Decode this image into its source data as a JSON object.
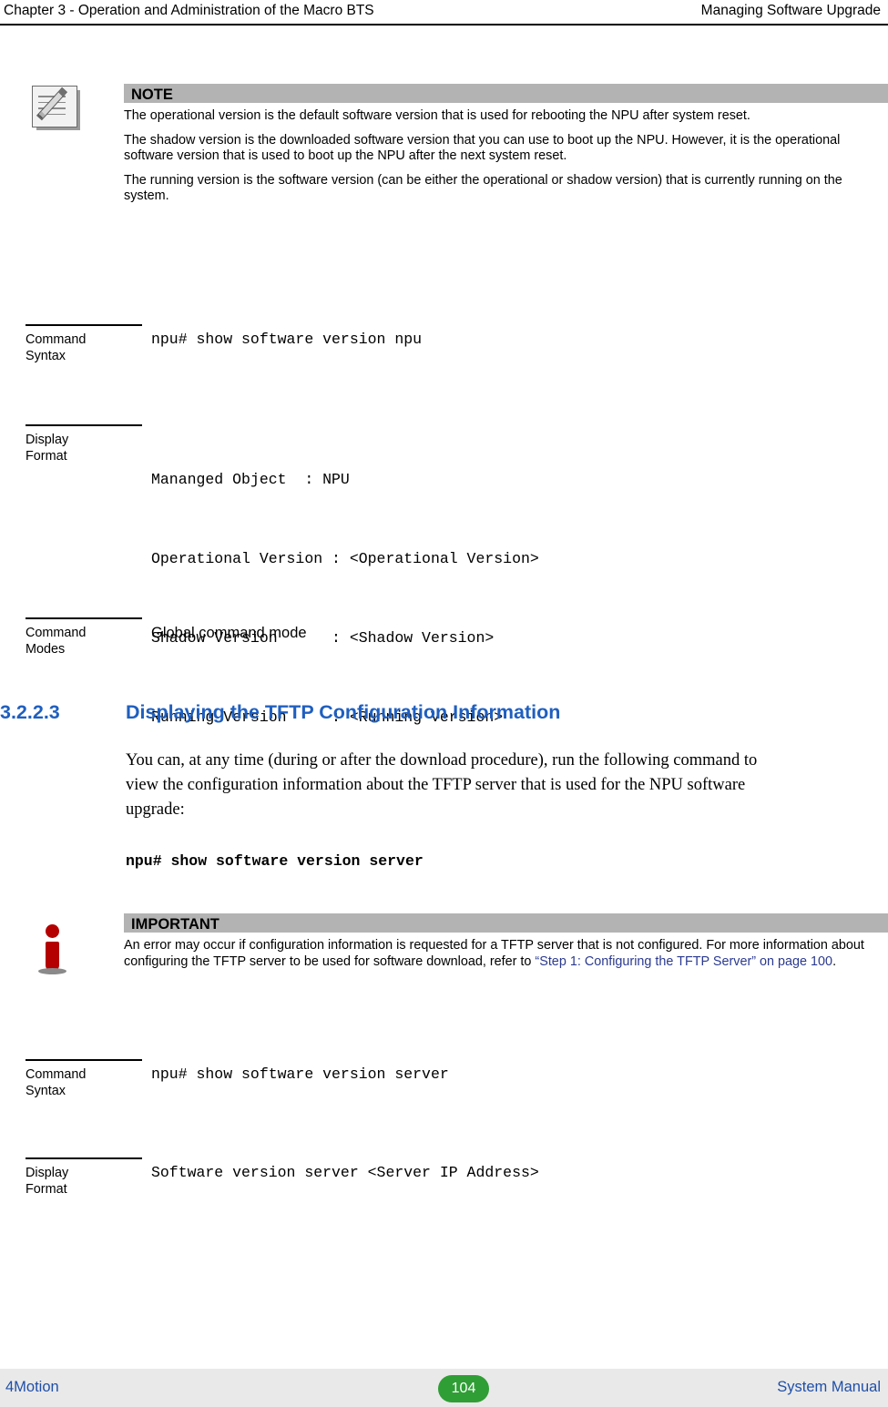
{
  "header": {
    "left": "Chapter 3 - Operation and Administration of the Macro BTS",
    "right": "Managing Software Upgrade"
  },
  "note": {
    "icon": "note-pencil-icon",
    "title": "NOTE",
    "paragraphs": [
      "The operational version is the default software version that is used for rebooting the NPU after system reset.",
      "The shadow version is the downloaded software version that you can use to boot up the NPU. However, it is the operational software version that is used to boot up the NPU after the next system reset.",
      "The running version is the software version (can be either the operational or shadow version) that is currently running on the system."
    ]
  },
  "block_syntax_1": {
    "label_line1": "Command",
    "label_line2": "Syntax",
    "value": "npu# show software version npu"
  },
  "block_display_1": {
    "label_line1": "Display",
    "label_line2": "Format",
    "lines": [
      "Mananged Object  : NPU",
      "Operational Version : <Operational Version>",
      "Shadow Version      : <Shadow Version>",
      "Running Version     : <Running Version>"
    ]
  },
  "block_modes_1": {
    "label_line1": "Command",
    "label_line2": "Modes",
    "value": "Global command mode"
  },
  "section": {
    "number": "3.2.2.3",
    "title": "Displaying the TFTP Configuration Information"
  },
  "paragraph": "You can, at any time (during or after the download procedure), run the following command to view the configuration information about the TFTP server that is used for the NPU software upgrade:",
  "inline_command": "npu# show software version server",
  "important": {
    "icon": "important-info-icon",
    "title": "IMPORTANT",
    "text_before_link": "An error may occur if configuration information is requested for a TFTP server that is not configured. For more information about configuring the TFTP server to be used for software download, refer to ",
    "link_text": "“Step 1: Configuring the TFTP Server” on page 100",
    "text_after_link": "."
  },
  "block_syntax_2": {
    "label_line1": "Command",
    "label_line2": "Syntax",
    "value": "npu# show software version server"
  },
  "block_display_2": {
    "label_line1": "Display",
    "label_line2": "Format",
    "value": "Software version server <Server IP Address>"
  },
  "footer": {
    "left": "4Motion",
    "page": "104",
    "right": "System Manual"
  },
  "colors": {
    "heading": "#1f5fbf",
    "callout_bar": "#b3b3b3",
    "footer_bg": "#e9e9e9",
    "page_badge": "#2f9e35",
    "footer_text": "#1f4fa8",
    "link": "#2b3a8f"
  }
}
